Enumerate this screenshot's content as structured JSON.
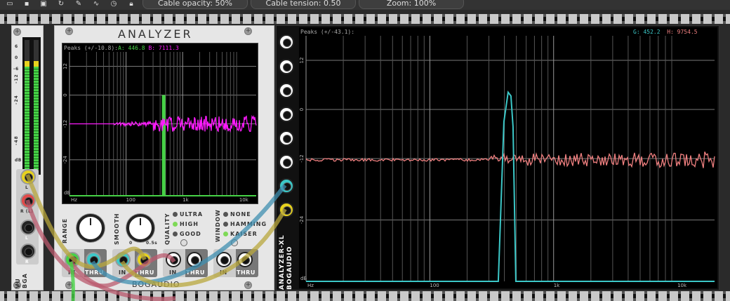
{
  "toolbar": {
    "icons": [
      "open-icon",
      "save-icon",
      "save-as-icon",
      "reload-icon",
      "wrench-icon",
      "cpu-icon",
      "clock-icon",
      "lock-icon"
    ],
    "cable_opacity": "Cable opacity: 50%",
    "cable_tension": "Cable tension: 0.50",
    "zoom": "Zoom: 100%"
  },
  "vu": {
    "scale": [
      "6",
      "0",
      "-6",
      "-12",
      "-24",
      "-48",
      "dB"
    ],
    "jack_labels": {
      "l": "L",
      "r": "R (L)",
      "l2": "L",
      "r2": "R"
    },
    "brand": "BGA",
    "name": "VU"
  },
  "analyzer": {
    "title": "ANALYZER",
    "header": {
      "peaks": "Peaks (+/-10.8):",
      "a_label": "A:",
      "a_value": "446.8",
      "b_label": "B:",
      "b_value": "7111.3"
    },
    "y_ticks": [
      "12",
      "0",
      "-12",
      "-24",
      "-48",
      "dB"
    ],
    "x_ticks": [
      "Hz",
      "100",
      "1k",
      "10k"
    ],
    "range_label": "RANGE",
    "smooth_label": "SMOOTH",
    "smooth_min": "0",
    "smooth_max": "0.5s",
    "quality_label": "QUALITY",
    "quality_options": [
      "ULTRA",
      "HIGH",
      "GOOD"
    ],
    "quality_selected": "HIGH",
    "window_label": "WINDOW",
    "window_options": [
      "NONE",
      "HAMMING",
      "KAISER"
    ],
    "window_selected": "KAISER",
    "in_label": "IN",
    "thru_label": "THRU",
    "brand": "BOGAUDIO"
  },
  "analyzer_xl": {
    "name": "ANALYZER-XL",
    "brand": "BOGAUDIO",
    "header": {
      "peaks": "Peaks (+/-43.1):",
      "g_label": "G:",
      "g_value": "452.2",
      "h_label": "H:",
      "h_value": "9754.5"
    },
    "y_ticks": [
      "12",
      "0",
      "-12",
      "-24",
      "-48",
      "dB"
    ],
    "x_ticks": [
      "Hz",
      "100",
      "1k",
      "10k"
    ]
  },
  "colors": {
    "green": "#46d246",
    "magenta": "#ff1aff",
    "cyan": "#3cc8c8",
    "salmon": "#f08080"
  }
}
